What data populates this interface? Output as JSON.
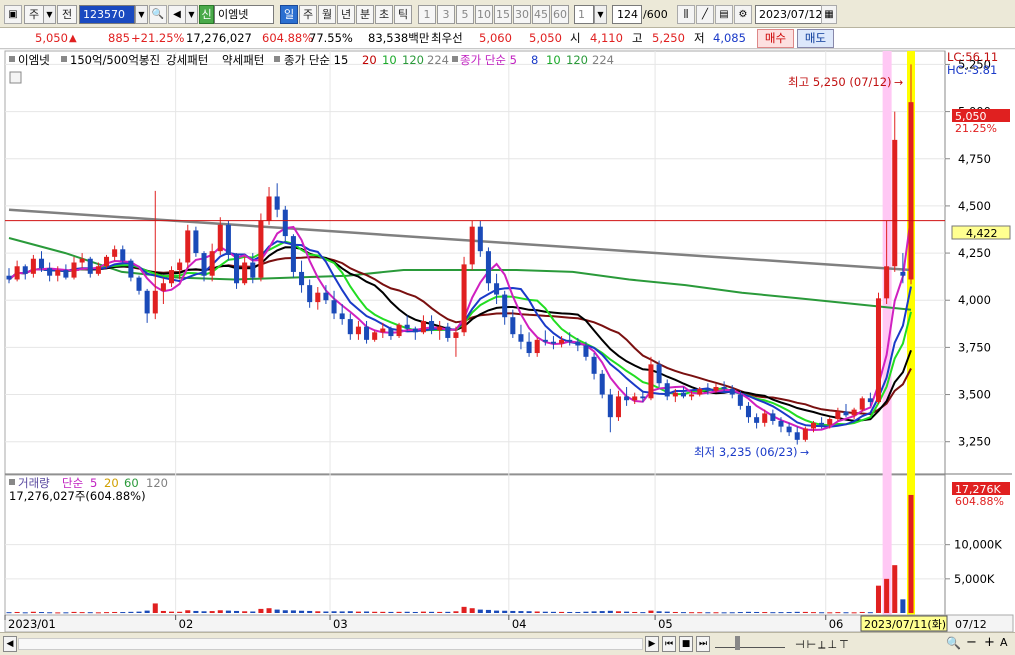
{
  "toolbar": {
    "code_prefix": "주",
    "code_prefix2": "전",
    "code": "123570",
    "new_badge": "신",
    "stock_name": "이엠넷",
    "periods": [
      "일",
      "주",
      "월",
      "년",
      "분",
      "초",
      "틱"
    ],
    "active_period": "일",
    "intervals": [
      "1",
      "3",
      "5",
      "10",
      "15",
      "30",
      "45",
      "60"
    ],
    "interval_value": "1",
    "count": "124",
    "total": "/600",
    "date": "2023/07/12"
  },
  "quote": {
    "price": "5,050",
    "change_arrow": "▲",
    "change": "885",
    "change_pct": "+21.25%",
    "volume": "17,276,027",
    "volume_ratio": "604.88%",
    "turnover_ratio": "77.55%",
    "amount": "83,538백만",
    "best_bid_label": "최우선",
    "best_ask": "5,060",
    "best_bid": "5,050",
    "open_label": "시",
    "open": "4,110",
    "high_label": "고",
    "high": "5,250",
    "low_label": "저",
    "low": "4,085",
    "buy_label": "매수",
    "sell_label": "매도"
  },
  "legend": {
    "name": "이엠넷",
    "indicator1": "150억/500억봉진",
    "indicator2": "강세패턴",
    "indicator3": "약세패턴",
    "ma_label": "종가 단순 15",
    "ma_periods": [
      "20",
      "10",
      "120",
      "224"
    ],
    "ma2_label": "종가 단순 5",
    "ma2_periods": [
      "8",
      "10",
      "120",
      "224"
    ]
  },
  "right_panel": {
    "lc": "LC:56.11",
    "hc": "HC:-3.81",
    "price_label": "5,050",
    "price_pct": "21.25%",
    "hline_label": "4,422",
    "vol_label": "17,276K",
    "vol_pct": "604.88%"
  },
  "volume_legend": {
    "label": "거래량",
    "type": "단순",
    "periods": [
      "5",
      "20",
      "60",
      "120"
    ],
    "value": "17,276,027주(604.88%)"
  },
  "annotations": {
    "max": "최고 5,250 (07/12)",
    "min": "최저 3,235 (06/23)"
  },
  "crosshair_date": "2023/07/11(화)",
  "last_date": "07/12",
  "colors": {
    "up": "#e02020",
    "down": "#1a4ab8",
    "accent": "#2b6fd0",
    "ma224": "#808080",
    "ma120": "#2a9a3a",
    "highlight": "#ffff00",
    "pink": "#ffb0f0"
  },
  "chart_data": {
    "type": "candlestick",
    "price_axis": {
      "ticks": [
        3250,
        3500,
        3750,
        4000,
        4250,
        4500,
        4750,
        5000,
        5250
      ],
      "range": [
        3100,
        5300
      ]
    },
    "volume_axis": {
      "ticks": [
        "5,000K",
        "10,000K"
      ]
    },
    "x_ticks": [
      "2023/01",
      "02",
      "03",
      "04",
      "05",
      "06"
    ],
    "horizontal_line": 4422,
    "candles": [
      [
        4130,
        4170,
        4090,
        4110,
        120
      ],
      [
        4110,
        4210,
        4100,
        4180,
        150
      ],
      [
        4180,
        4190,
        4110,
        4140,
        100
      ],
      [
        4140,
        4240,
        4120,
        4220,
        180
      ],
      [
        4220,
        4260,
        4150,
        4170,
        140
      ],
      [
        4170,
        4200,
        4100,
        4130,
        110
      ],
      [
        4130,
        4180,
        4100,
        4160,
        90
      ],
      [
        4160,
        4190,
        4110,
        4120,
        100
      ],
      [
        4120,
        4230,
        4110,
        4200,
        160
      ],
      [
        4200,
        4250,
        4170,
        4220,
        130
      ],
      [
        4220,
        4230,
        4120,
        4140,
        120
      ],
      [
        4140,
        4200,
        4130,
        4180,
        100
      ],
      [
        4180,
        4240,
        4170,
        4230,
        130
      ],
      [
        4230,
        4290,
        4210,
        4270,
        150
      ],
      [
        4270,
        4290,
        4190,
        4210,
        140
      ],
      [
        4210,
        4220,
        4100,
        4120,
        170
      ],
      [
        4120,
        4130,
        4030,
        4050,
        200
      ],
      [
        4050,
        4060,
        3880,
        3930,
        350
      ],
      [
        3930,
        4580,
        3900,
        4050,
        1400
      ],
      [
        4050,
        4120,
        3980,
        4090,
        300
      ],
      [
        4090,
        4180,
        4070,
        4160,
        200
      ],
      [
        4160,
        4220,
        4110,
        4200,
        180
      ],
      [
        4200,
        4400,
        4170,
        4370,
        400
      ],
      [
        4370,
        4390,
        4230,
        4250,
        300
      ],
      [
        4250,
        4260,
        4100,
        4130,
        250
      ],
      [
        4130,
        4300,
        4100,
        4260,
        280
      ],
      [
        4260,
        4440,
        4240,
        4400,
        400
      ],
      [
        4400,
        4420,
        4210,
        4240,
        350
      ],
      [
        4240,
        4250,
        4060,
        4090,
        300
      ],
      [
        4090,
        4230,
        4080,
        4200,
        250
      ],
      [
        4200,
        4250,
        4090,
        4120,
        220
      ],
      [
        4120,
        4460,
        4100,
        4420,
        600
      ],
      [
        4420,
        4600,
        4400,
        4550,
        700
      ],
      [
        4550,
        4620,
        4440,
        4480,
        500
      ],
      [
        4480,
        4500,
        4300,
        4340,
        400
      ],
      [
        4340,
        4350,
        4120,
        4150,
        380
      ],
      [
        4150,
        4210,
        4040,
        4080,
        330
      ],
      [
        4080,
        4110,
        3960,
        3990,
        300
      ],
      [
        3990,
        4070,
        3950,
        4040,
        250
      ],
      [
        4040,
        4080,
        3980,
        4000,
        220
      ],
      [
        4000,
        4050,
        3900,
        3930,
        250
      ],
      [
        3930,
        3980,
        3870,
        3900,
        230
      ],
      [
        3900,
        3930,
        3790,
        3820,
        260
      ],
      [
        3820,
        3890,
        3790,
        3860,
        200
      ],
      [
        3860,
        3890,
        3770,
        3790,
        220
      ],
      [
        3790,
        3840,
        3780,
        3830,
        180
      ],
      [
        3830,
        3880,
        3800,
        3850,
        170
      ],
      [
        3850,
        3860,
        3790,
        3810,
        160
      ],
      [
        3810,
        3880,
        3800,
        3870,
        170
      ],
      [
        3870,
        3920,
        3840,
        3850,
        180
      ],
      [
        3850,
        3860,
        3790,
        3830,
        150
      ],
      [
        3830,
        3920,
        3820,
        3890,
        200
      ],
      [
        3890,
        3920,
        3820,
        3840,
        170
      ],
      [
        3840,
        3890,
        3790,
        3860,
        160
      ],
      [
        3860,
        3880,
        3780,
        3800,
        170
      ],
      [
        3800,
        3860,
        3700,
        3830,
        250
      ],
      [
        3830,
        4230,
        3810,
        4190,
        900
      ],
      [
        4190,
        4420,
        4160,
        4390,
        700
      ],
      [
        4390,
        4420,
        4230,
        4260,
        500
      ],
      [
        4260,
        4280,
        4050,
        4090,
        450
      ],
      [
        4090,
        4140,
        3980,
        4030,
        350
      ],
      [
        4030,
        4050,
        3870,
        3910,
        330
      ],
      [
        3910,
        3950,
        3800,
        3820,
        300
      ],
      [
        3820,
        3870,
        3740,
        3780,
        280
      ],
      [
        3780,
        3830,
        3700,
        3720,
        260
      ],
      [
        3720,
        3800,
        3700,
        3790,
        220
      ],
      [
        3790,
        3840,
        3760,
        3780,
        190
      ],
      [
        3780,
        3810,
        3740,
        3770,
        170
      ],
      [
        3770,
        3810,
        3750,
        3790,
        160
      ],
      [
        3790,
        3830,
        3760,
        3780,
        150
      ],
      [
        3780,
        3800,
        3730,
        3760,
        150
      ],
      [
        3760,
        3780,
        3680,
        3700,
        190
      ],
      [
        3700,
        3720,
        3580,
        3610,
        240
      ],
      [
        3610,
        3630,
        3480,
        3500,
        280
      ],
      [
        3500,
        3530,
        3300,
        3380,
        320
      ],
      [
        3380,
        3520,
        3360,
        3490,
        250
      ],
      [
        3490,
        3540,
        3440,
        3470,
        200
      ],
      [
        3470,
        3510,
        3450,
        3490,
        150
      ],
      [
        3490,
        3520,
        3460,
        3480,
        130
      ],
      [
        3480,
        3700,
        3470,
        3660,
        350
      ],
      [
        3660,
        3680,
        3540,
        3560,
        250
      ],
      [
        3560,
        3580,
        3470,
        3490,
        200
      ],
      [
        3490,
        3530,
        3460,
        3510,
        150
      ],
      [
        3510,
        3540,
        3480,
        3490,
        130
      ],
      [
        3490,
        3520,
        3470,
        3500,
        120
      ],
      [
        3500,
        3540,
        3490,
        3530,
        120
      ],
      [
        3530,
        3560,
        3500,
        3520,
        110
      ],
      [
        3520,
        3560,
        3510,
        3540,
        110
      ],
      [
        3540,
        3570,
        3510,
        3530,
        100
      ],
      [
        3530,
        3550,
        3480,
        3500,
        110
      ],
      [
        3500,
        3520,
        3420,
        3440,
        140
      ],
      [
        3440,
        3460,
        3350,
        3380,
        170
      ],
      [
        3380,
        3400,
        3320,
        3350,
        150
      ],
      [
        3350,
        3420,
        3330,
        3400,
        140
      ],
      [
        3400,
        3420,
        3340,
        3360,
        120
      ],
      [
        3360,
        3380,
        3300,
        3330,
        130
      ],
      [
        3330,
        3350,
        3280,
        3300,
        140
      ],
      [
        3300,
        3330,
        3235,
        3260,
        170
      ],
      [
        3260,
        3330,
        3250,
        3320,
        160
      ],
      [
        3320,
        3360,
        3300,
        3350,
        130
      ],
      [
        3350,
        3380,
        3320,
        3340,
        110
      ],
      [
        3340,
        3380,
        3320,
        3370,
        100
      ],
      [
        3370,
        3430,
        3360,
        3410,
        130
      ],
      [
        3410,
        3450,
        3380,
        3390,
        110
      ],
      [
        3390,
        3430,
        3370,
        3420,
        100
      ],
      [
        3420,
        3490,
        3410,
        3480,
        150
      ],
      [
        3480,
        3510,
        3440,
        3460,
        120
      ],
      [
        3460,
        4040,
        3450,
        4010,
        4000
      ],
      [
        4010,
        4420,
        3980,
        4180,
        5000
      ],
      [
        4180,
        5000,
        4150,
        4850,
        7000
      ],
      [
        4150,
        4250,
        4090,
        4130,
        2000
      ],
      [
        4110,
        5250,
        4085,
        5050,
        17276
      ]
    ],
    "ma": {
      "ma224": [
        4480,
        4460,
        4440,
        4420,
        4400,
        4380,
        4360,
        4340,
        4320,
        4300,
        4280,
        4260,
        4240,
        4220,
        4200,
        4180,
        4160
      ],
      "ma120": [
        4330,
        4250,
        4150,
        4120,
        4110,
        4120,
        4130,
        4160,
        4160,
        4160,
        4150,
        4110,
        4080,
        4040,
        4010,
        3980,
        3950
      ]
    }
  }
}
